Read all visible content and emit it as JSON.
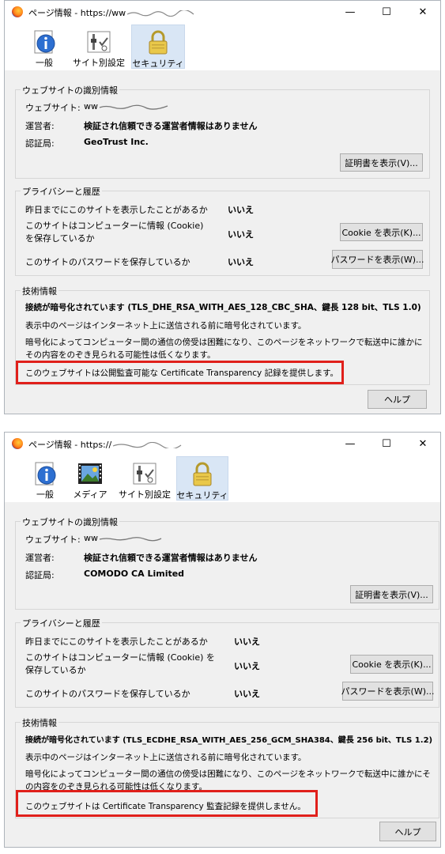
{
  "dialogs": [
    {
      "title": "ページ情報 - https://ww",
      "window_controls": {
        "minimize": "—",
        "maximize": "☐",
        "close": "✕"
      },
      "tabs": [
        "一般",
        "サイト別設定",
        "セキュリティ"
      ],
      "identity": {
        "heading": "ウェブサイトの識別情報",
        "website_label": "ウェブサイト:",
        "website_value": "ww",
        "owner_label": "運営者:",
        "owner_value": "検証され信頼できる運営者情報はありません",
        "verifier_label": "認証局:",
        "verifier_value": "GeoTrust Inc.",
        "view_cert_button": "証明書を表示(V)..."
      },
      "privacy": {
        "heading": "プライバシーと履歴",
        "q1": "昨日までにこのサイトを表示したことがあるか",
        "a1": "いいえ",
        "q2": "このサイトはコンピューターに情報 (Cookie) を保存しているか",
        "a2": "いいえ",
        "cookie_button": "Cookie を表示(K)...",
        "q3": "このサイトのパスワードを保存しているか",
        "a3": "いいえ",
        "password_button": "パスワードを表示(W)..."
      },
      "tech": {
        "heading": "技術情報",
        "encryption": "接続が暗号化されています (TLS_DHE_RSA_WITH_AES_128_CBC_SHA、鍵長 128 bit、TLS 1.0)",
        "line1": "表示中のページはインターネット上に送信される前に暗号化されています。",
        "line2": "暗号化によってコンピューター間の通信の傍受は困難になり、このページをネットワークで転送中に誰かにその内容をのぞき見られる可能性は低くなります。",
        "ct": "このウェブサイトは公開監査可能な Certificate Transparency 記録を提供します。"
      },
      "help_button": "ヘルプ"
    },
    {
      "title": "ページ情報 - https://",
      "window_controls": {
        "minimize": "—",
        "maximize": "☐",
        "close": "✕"
      },
      "tabs": [
        "一般",
        "メディア",
        "サイト別設定",
        "セキュリティ"
      ],
      "identity": {
        "heading": "ウェブサイトの識別情報",
        "website_label": "ウェブサイト:",
        "website_value": "ww",
        "owner_label": "運営者:",
        "owner_value": "検証され信頼できる運営者情報はありません",
        "verifier_label": "認証局:",
        "verifier_value": "COMODO CA Limited",
        "view_cert_button": "証明書を表示(V)..."
      },
      "privacy": {
        "heading": "プライバシーと履歴",
        "q1": "昨日までにこのサイトを表示したことがあるか",
        "a1": "いいえ",
        "q2": "このサイトはコンピューターに情報 (Cookie) を保存しているか",
        "a2": "いいえ",
        "cookie_button": "Cookie を表示(K)...",
        "q3": "このサイトのパスワードを保存しているか",
        "a3": "いいえ",
        "password_button": "パスワードを表示(W)..."
      },
      "tech": {
        "heading": "技術情報",
        "encryption": "接続が暗号化されています (TLS_ECDHE_RSA_WITH_AES_256_GCM_SHA384、鍵長 256 bit、TLS 1.2)",
        "line1": "表示中のページはインターネット上に送信される前に暗号化されています。",
        "line2": "暗号化によってコンピューター間の通信の傍受は困難になり、このページをネットワークで転送中に誰かにその内容をのぞき見られる可能性は低くなります。",
        "ct": "このウェブサイトは Certificate Transparency 監査記録を提供しません。"
      },
      "help_button": "ヘルプ"
    }
  ]
}
